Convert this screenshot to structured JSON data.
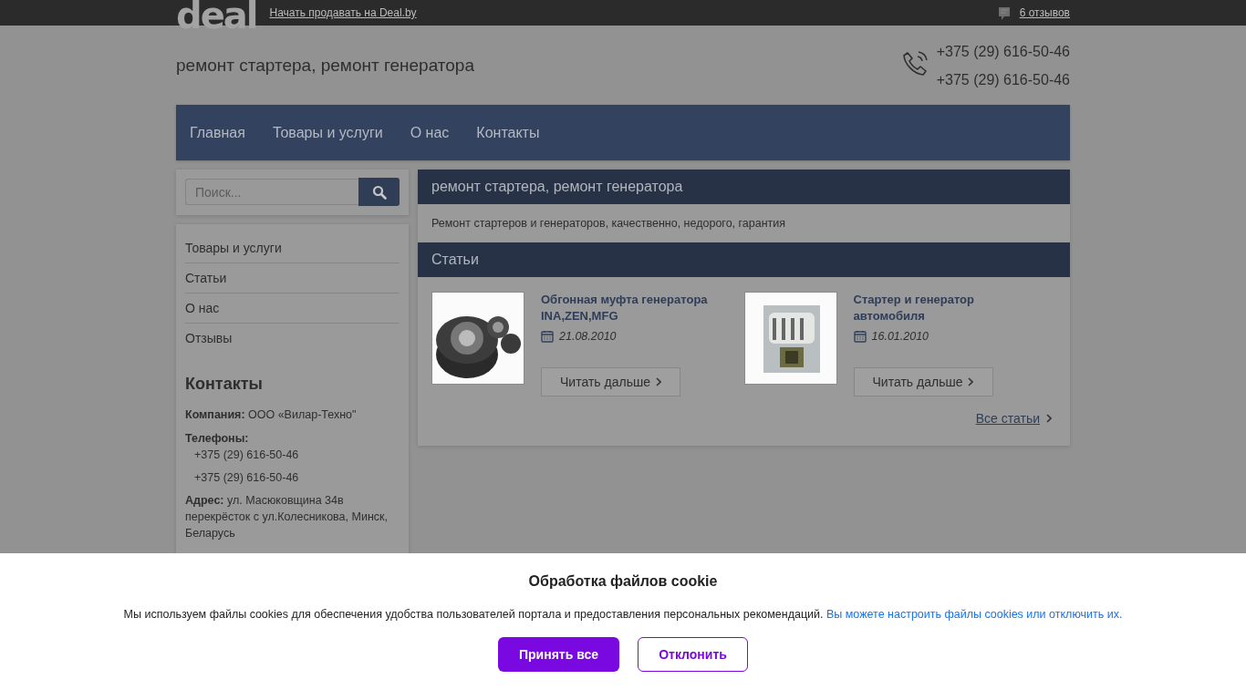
{
  "topbar": {
    "logo": "deal",
    "sell_link": "Начать продавать на Deal.by",
    "reviews_link": "6 отзывов"
  },
  "header": {
    "title": "ремонт стартера, ремонт генератора",
    "phones": [
      "+375 (29) 616-50-46",
      "+375 (29) 616-50-46"
    ]
  },
  "nav": {
    "items": [
      {
        "label": "Главная"
      },
      {
        "label": "Товары и услуги"
      },
      {
        "label": "О нас"
      },
      {
        "label": "Контакты"
      }
    ]
  },
  "sidebar": {
    "search": {
      "placeholder": "Поиск..."
    },
    "menu": [
      {
        "label": "Товары и услуги"
      },
      {
        "label": "Статьи"
      },
      {
        "label": "О нас"
      },
      {
        "label": "Отзывы"
      }
    ],
    "contacts": {
      "title": "Контакты",
      "company_label": "Компания:",
      "company": "ООО «Вилар-Техно\"",
      "phones_label": "Телефоны:",
      "phones": [
        "+375 (29) 616-50-46",
        "+375 (29) 616-50-46"
      ],
      "address": "**Адрес:** ул. Масюковщина 34в перекрёсток с ул.Колесникова, Минск, Беларусь"
    }
  },
  "main": {
    "title": "ремонт стартера, ремонт генератора",
    "description": "Ремонт стартеров и генераторов, качественно, недорого, гарантия",
    "articles_title": "Статьи",
    "articles": [
      {
        "title": "Обгонная муфта генератора INA,ZEN,MFG",
        "date": "21.08.2010",
        "button": "Читать дальше"
      },
      {
        "title": "Стартер и генератор автомобиля",
        "date": "16.01.2010",
        "button": "Читать дальше"
      }
    ],
    "all_link": "Все статьи"
  },
  "cookie": {
    "title": "Обработка файлов cookie",
    "text": "Мы используем файлы cookies для обеспечения удобства пользователей портала и предоставления персональных рекомендаций.",
    "link": "Вы можете настроить файлы cookies или отключить их.",
    "accept": "Принять все",
    "decline": "Отклонить"
  }
}
